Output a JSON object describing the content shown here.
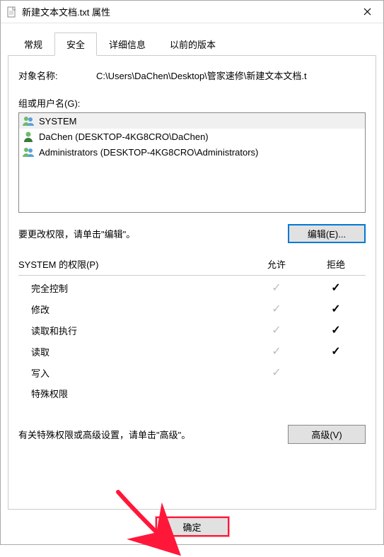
{
  "title": "新建文本文档.txt 属性",
  "tabs": [
    "常规",
    "安全",
    "详细信息",
    "以前的版本"
  ],
  "active_tab": 1,
  "object_label": "对象名称:",
  "object_path": "C:\\Users\\DaChen\\Desktop\\管家速修\\新建文本文档.t",
  "group_label": "组或用户名(G):",
  "users": [
    {
      "name": "SYSTEM",
      "icon": "group"
    },
    {
      "name": "DaChen (DESKTOP-4KG8CRO\\DaChen)",
      "icon": "user"
    },
    {
      "name": "Administrators (DESKTOP-4KG8CRO\\Administrators)",
      "icon": "group"
    }
  ],
  "edit_hint": "要更改权限，请单击\"编辑\"。",
  "edit_btn": "编辑(E)...",
  "perm_title": "SYSTEM 的权限(P)",
  "perm_cols": {
    "allow": "允许",
    "deny": "拒绝"
  },
  "permissions": [
    {
      "name": "完全控制",
      "allow": "gray",
      "deny": "black"
    },
    {
      "name": "修改",
      "allow": "gray",
      "deny": "black"
    },
    {
      "name": "读取和执行",
      "allow": "gray",
      "deny": "black"
    },
    {
      "name": "读取",
      "allow": "gray",
      "deny": "black"
    },
    {
      "name": "写入",
      "allow": "gray",
      "deny": ""
    },
    {
      "name": "特殊权限",
      "allow": "",
      "deny": ""
    }
  ],
  "advanced_hint": "有关特殊权限或高级设置，请单击\"高级\"。",
  "advanced_btn": "高级(V)",
  "ok_btn": "确定"
}
